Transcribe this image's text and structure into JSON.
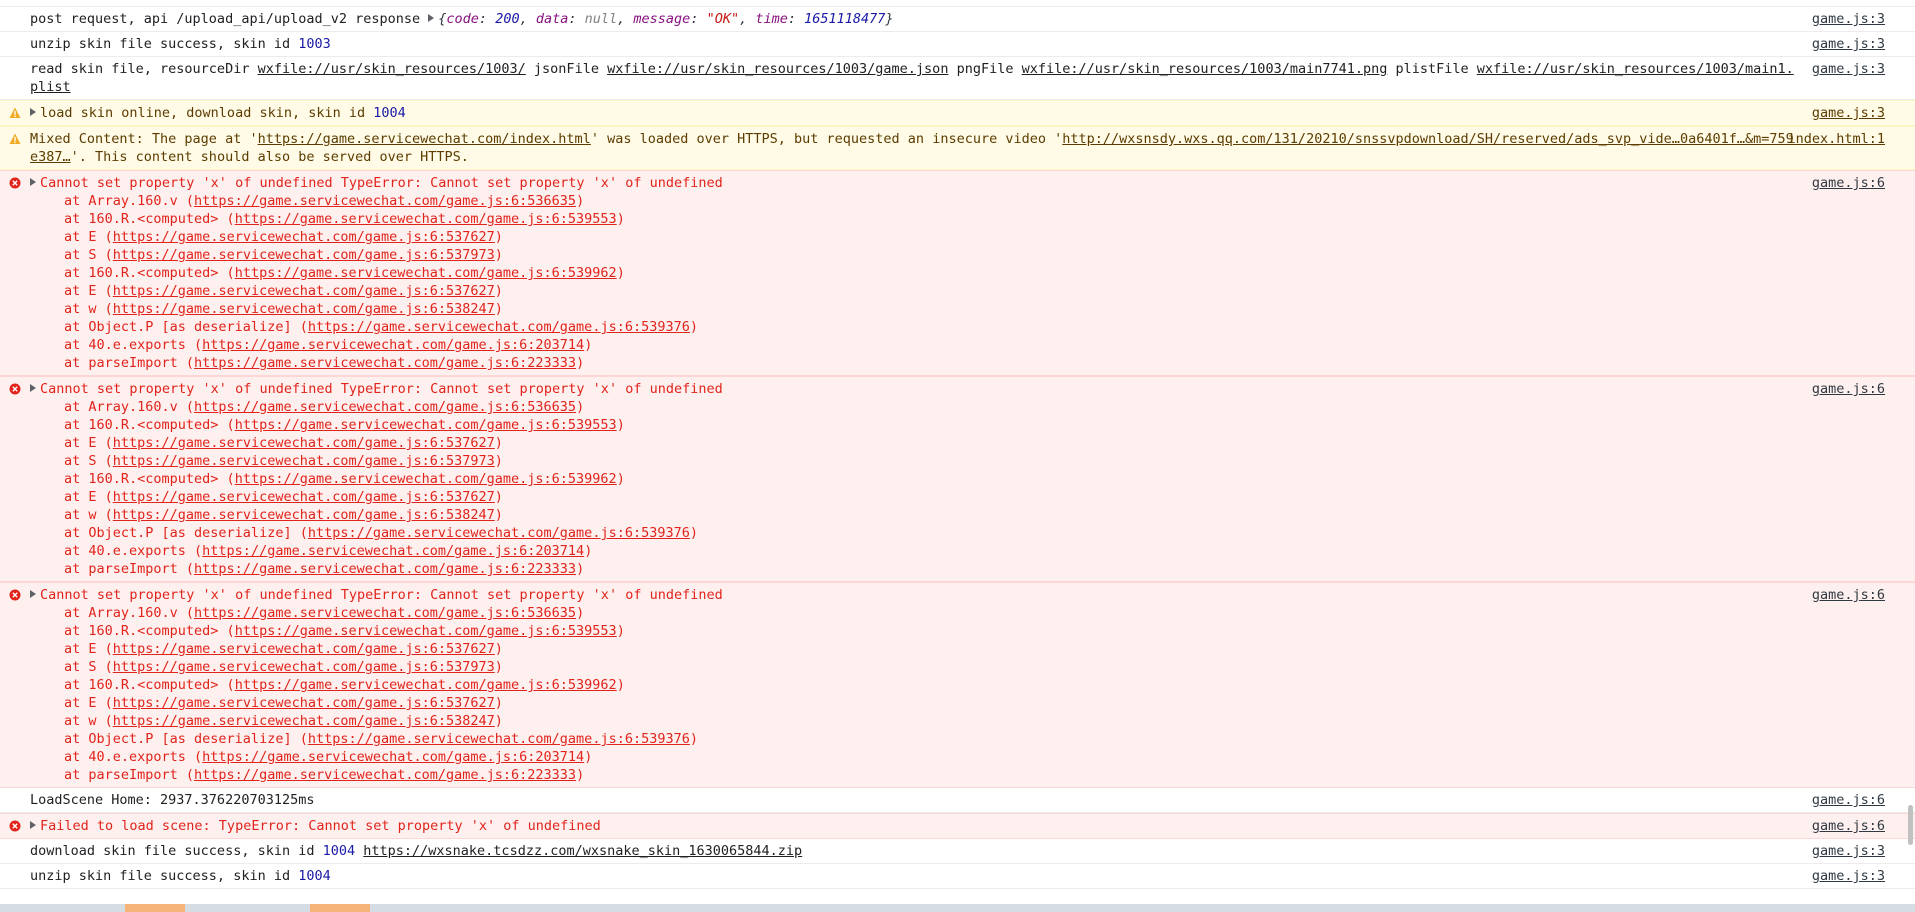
{
  "colors": {
    "error_text": "#e0241b",
    "error_bg": "#fff0f0",
    "warn_bg": "#fffbe6",
    "number": "#1a1aa6",
    "accent_orange": "#f5b47a"
  },
  "rows": [
    {
      "prefix": "post request, api /upload_api/upload_v2 response ",
      "obj": {
        "k1": "code",
        "v1": "200",
        "k2": "data",
        "v2": "null",
        "k3": "message",
        "v3": "\"OK\"",
        "k4": "time",
        "v4": "1651118477"
      },
      "source": "game.js:3"
    },
    {
      "text": "unzip skin file success, skin id ",
      "id": "1003",
      "source": "game.js:3"
    },
    {
      "p1": "read skin file, resourceDir ",
      "l1": "wxfile://usr/skin_resources/1003/",
      "p2": " jsonFile ",
      "l2": "wxfile://usr/skin_resources/1003/game.json",
      "p3": " pngFile ",
      "l3": "wxfile://usr/skin_resources/1003/main7741.png",
      "p4": " plistFile ",
      "l4": "wxfile://usr/skin_resources/1003/main1.plist",
      "source": "game.js:3"
    },
    {
      "text": "load skin online, download skin, skin id ",
      "id": "1004",
      "source": "game.js:3",
      "icon": "warning-icon"
    },
    {
      "p1": "Mixed Content: The page at '",
      "l1": "https://game.servicewechat.com/index.html",
      "p2": "' was loaded over HTTPS, but requested an insecure video '",
      "l2": "http://wxsnsdy.wxs.qq.com/131/20210/snssvpdownload/SH/reserved/ads_svp_vide…0a6401f…&m=759e387…",
      "p3": "'. This content should also be served over HTTPS.",
      "source": "index.html:1",
      "icon": "warning-icon"
    }
  ],
  "errors": [
    {
      "message": "Cannot set property 'x' of undefined TypeError: Cannot set property 'x' of undefined",
      "source": "game.js:6",
      "icon": "error-icon",
      "stack": [
        {
          "fn": "at Array.160.v (",
          "url": "https://game.servicewechat.com/game.js:6:536635",
          "end": ")"
        },
        {
          "fn": "at 160.R.<computed> (",
          "url": "https://game.servicewechat.com/game.js:6:539553",
          "end": ")"
        },
        {
          "fn": "at E (",
          "url": "https://game.servicewechat.com/game.js:6:537627",
          "end": ")"
        },
        {
          "fn": "at S (",
          "url": "https://game.servicewechat.com/game.js:6:537973",
          "end": ")"
        },
        {
          "fn": "at 160.R.<computed> (",
          "url": "https://game.servicewechat.com/game.js:6:539962",
          "end": ")"
        },
        {
          "fn": "at E (",
          "url": "https://game.servicewechat.com/game.js:6:537627",
          "end": ")"
        },
        {
          "fn": "at w (",
          "url": "https://game.servicewechat.com/game.js:6:538247",
          "end": ")"
        },
        {
          "fn": "at Object.P [as deserialize] (",
          "url": "https://game.servicewechat.com/game.js:6:539376",
          "end": ")"
        },
        {
          "fn": "at 40.e.exports (",
          "url": "https://game.servicewechat.com/game.js:6:203714",
          "end": ")"
        },
        {
          "fn": "at parseImport (",
          "url": "https://game.servicewechat.com/game.js:6:223333",
          "end": ")"
        }
      ]
    },
    {
      "message": "Cannot set property 'x' of undefined TypeError: Cannot set property 'x' of undefined",
      "source": "game.js:6",
      "icon": "error-icon",
      "stack": [
        {
          "fn": "at Array.160.v (",
          "url": "https://game.servicewechat.com/game.js:6:536635",
          "end": ")"
        },
        {
          "fn": "at 160.R.<computed> (",
          "url": "https://game.servicewechat.com/game.js:6:539553",
          "end": ")"
        },
        {
          "fn": "at E (",
          "url": "https://game.servicewechat.com/game.js:6:537627",
          "end": ")"
        },
        {
          "fn": "at S (",
          "url": "https://game.servicewechat.com/game.js:6:537973",
          "end": ")"
        },
        {
          "fn": "at 160.R.<computed> (",
          "url": "https://game.servicewechat.com/game.js:6:539962",
          "end": ")"
        },
        {
          "fn": "at E (",
          "url": "https://game.servicewechat.com/game.js:6:537627",
          "end": ")"
        },
        {
          "fn": "at w (",
          "url": "https://game.servicewechat.com/game.js:6:538247",
          "end": ")"
        },
        {
          "fn": "at Object.P [as deserialize] (",
          "url": "https://game.servicewechat.com/game.js:6:539376",
          "end": ")"
        },
        {
          "fn": "at 40.e.exports (",
          "url": "https://game.servicewechat.com/game.js:6:203714",
          "end": ")"
        },
        {
          "fn": "at parseImport (",
          "url": "https://game.servicewechat.com/game.js:6:223333",
          "end": ")"
        }
      ]
    },
    {
      "message": "Cannot set property 'x' of undefined TypeError: Cannot set property 'x' of undefined",
      "source": "game.js:6",
      "icon": "error-icon",
      "stack": [
        {
          "fn": "at Array.160.v (",
          "url": "https://game.servicewechat.com/game.js:6:536635",
          "end": ")"
        },
        {
          "fn": "at 160.R.<computed> (",
          "url": "https://game.servicewechat.com/game.js:6:539553",
          "end": ")"
        },
        {
          "fn": "at E (",
          "url": "https://game.servicewechat.com/game.js:6:537627",
          "end": ")"
        },
        {
          "fn": "at S (",
          "url": "https://game.servicewechat.com/game.js:6:537973",
          "end": ")"
        },
        {
          "fn": "at 160.R.<computed> (",
          "url": "https://game.servicewechat.com/game.js:6:539962",
          "end": ")"
        },
        {
          "fn": "at E (",
          "url": "https://game.servicewechat.com/game.js:6:537627",
          "end": ")"
        },
        {
          "fn": "at w (",
          "url": "https://game.servicewechat.com/game.js:6:538247",
          "end": ")"
        },
        {
          "fn": "at Object.P [as deserialize] (",
          "url": "https://game.servicewechat.com/game.js:6:539376",
          "end": ")"
        },
        {
          "fn": "at 40.e.exports (",
          "url": "https://game.servicewechat.com/game.js:6:203714",
          "end": ")"
        },
        {
          "fn": "at parseImport (",
          "url": "https://game.servicewechat.com/game.js:6:223333",
          "end": ")"
        }
      ]
    }
  ],
  "tail": [
    {
      "text": "LoadScene Home: 2937.376220703125ms",
      "source": "game.js:6"
    },
    {
      "text": "Failed to load scene: TypeError: Cannot set property 'x' of undefined",
      "source": "game.js:6",
      "icon": "error-icon"
    },
    {
      "text": "download skin file success, skin id ",
      "id": "1004",
      "url": "https://wxsnake.tcsdzz.com/wxsnake_skin_1630065844.zip",
      "source": "game.js:3"
    },
    {
      "text": "unzip skin file success, skin id ",
      "id": "1004",
      "source": "game.js:3"
    }
  ]
}
